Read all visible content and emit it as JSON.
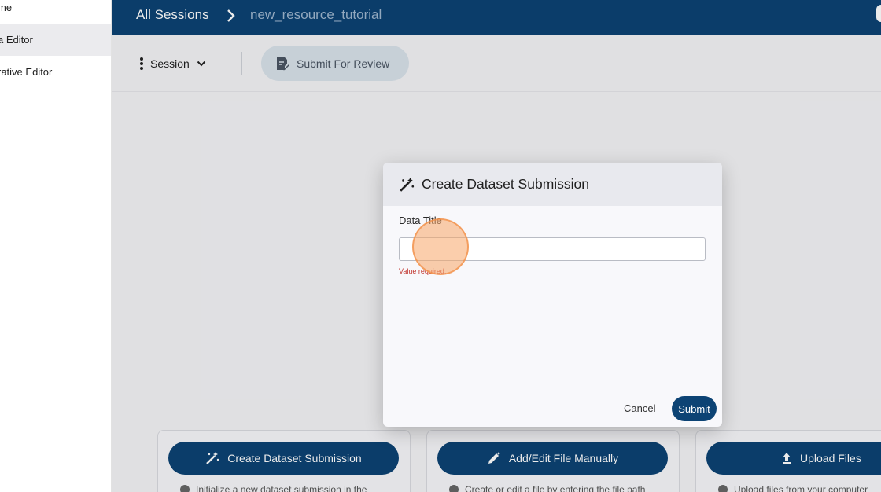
{
  "sidebar": {
    "items": [
      {
        "label": "me"
      },
      {
        "label": "a Editor"
      },
      {
        "label": "rative Editor"
      }
    ]
  },
  "header": {
    "breadcrumb_root": "All Sessions",
    "breadcrumb_current": "new_resource_tutorial"
  },
  "toolbar": {
    "session_label": "Session",
    "submit_review_label": "Submit For Review"
  },
  "cards": [
    {
      "button_label": "Create Dataset Submission",
      "description": "Initialize a new dataset submission in the"
    },
    {
      "button_label": "Add/Edit File Manually",
      "description": "Create or edit a file by entering the file path"
    },
    {
      "button_label": "Upload Files",
      "description": "Upload files from your computer"
    }
  ],
  "dialog": {
    "title": "Create Dataset Submission",
    "field_label": "Data Title",
    "field_value": "",
    "error_text": "Value required.",
    "cancel_label": "Cancel",
    "submit_label": "Submit"
  },
  "colors": {
    "primary": "#0c4374",
    "error": "#c0332c",
    "click_highlight": "#f7a667"
  }
}
